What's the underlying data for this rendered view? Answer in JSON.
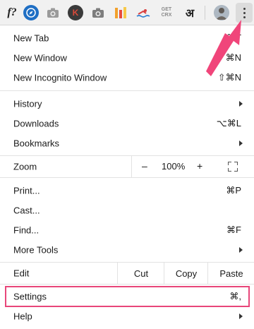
{
  "toolbar": {
    "extensions": [
      {
        "name": "f?",
        "icon": "f-question-icon"
      },
      {
        "name": "compass",
        "icon": "compass-icon"
      },
      {
        "name": "camera",
        "icon": "camera-icon"
      },
      {
        "name": "K",
        "icon": "k-icon"
      },
      {
        "name": "camera",
        "icon": "camera-icon"
      },
      {
        "name": "bars",
        "icon": "bars-icon"
      },
      {
        "name": "swimmer",
        "icon": "swimmer-icon"
      },
      {
        "name": "get-crx",
        "icon": "get-crx-icon"
      },
      {
        "name": "hindi",
        "icon": "hindi-icon"
      }
    ],
    "f_text": "f?",
    "k_text": "K",
    "getcrx_line1": "GET",
    "getcrx_line2": "CRX",
    "hindi_text": "अ"
  },
  "menu": {
    "new_tab": {
      "label": "New Tab",
      "shortcut": "⌘T"
    },
    "new_window": {
      "label": "New Window",
      "shortcut": "⌘N"
    },
    "new_incognito": {
      "label": "New Incognito Window",
      "shortcut": "⇧⌘N"
    },
    "history": {
      "label": "History"
    },
    "downloads": {
      "label": "Downloads",
      "shortcut": "⌥⌘L"
    },
    "bookmarks": {
      "label": "Bookmarks"
    },
    "zoom": {
      "label": "Zoom",
      "minus": "–",
      "level": "100%",
      "plus": "+"
    },
    "print": {
      "label": "Print...",
      "shortcut": "⌘P"
    },
    "cast": {
      "label": "Cast..."
    },
    "find": {
      "label": "Find...",
      "shortcut": "⌘F"
    },
    "more_tools": {
      "label": "More Tools"
    },
    "edit": {
      "label": "Edit",
      "cut": "Cut",
      "copy": "Copy",
      "paste": "Paste"
    },
    "settings": {
      "label": "Settings",
      "shortcut": "⌘,"
    },
    "help": {
      "label": "Help"
    }
  },
  "colors": {
    "highlight": "#e8467a",
    "arrow": "#f0457a"
  }
}
